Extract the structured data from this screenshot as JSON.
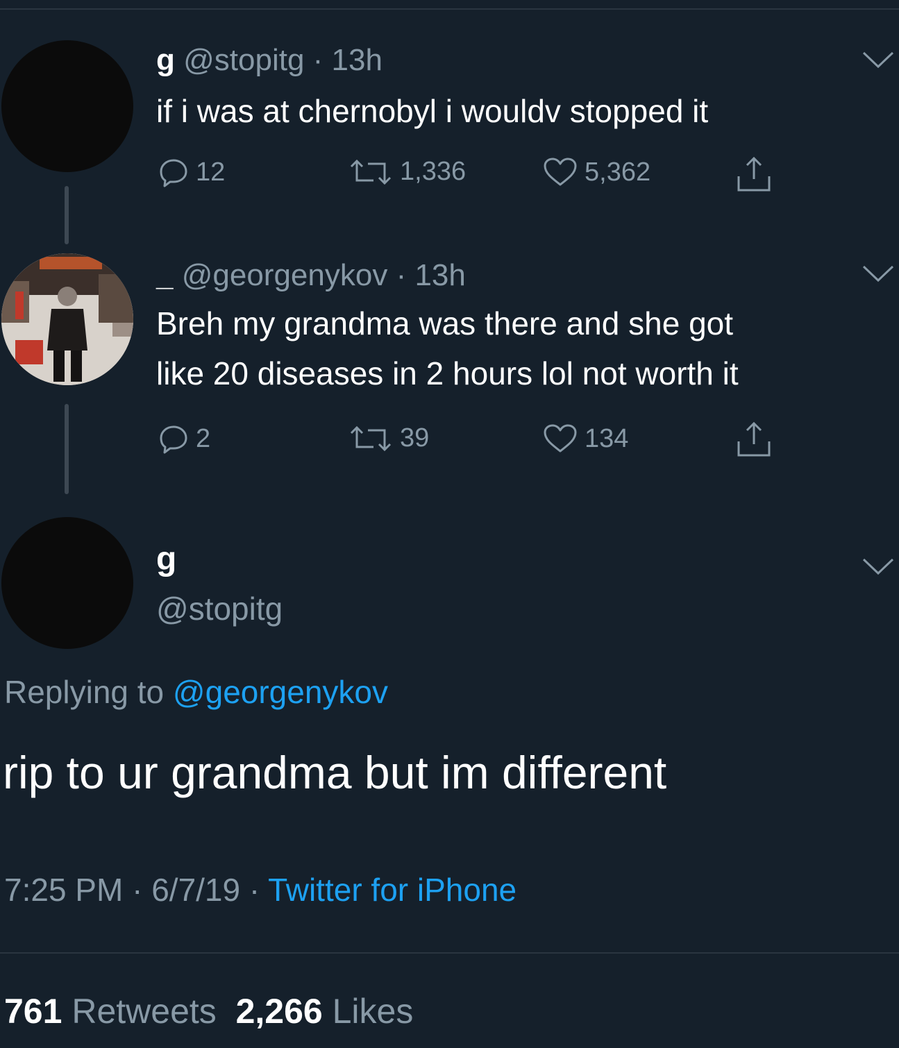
{
  "tweet1": {
    "name": "g",
    "handle": "@stopitg",
    "time": "13h",
    "text": "if i was at chernobyl i wouldv stopped it",
    "replies": "12",
    "retweets": "1,336",
    "likes": "5,362"
  },
  "tweet2": {
    "name": "_",
    "handle": "@georgenykov",
    "time": "13h",
    "text_line1": "Breh my grandma was there and she got",
    "text_line2": "like 20 diseases in 2 hours lol not worth it",
    "replies": "2",
    "retweets": "39",
    "likes": "134"
  },
  "main_tweet": {
    "name": "g",
    "handle": "@stopitg",
    "replying_prefix": "Replying to",
    "replying_to": "@georgenykov",
    "text": "rip to ur grandma but im different",
    "time": "7:25 PM",
    "date": "6/7/19",
    "source": "Twitter for iPhone",
    "retweet_count": "761",
    "retweet_label": "Retweets",
    "like_count": "2,266",
    "like_label": "Likes"
  },
  "icons": {
    "reply": "reply-icon",
    "retweet": "retweet-icon",
    "like": "heart-icon",
    "share": "share-icon",
    "menu": "chevron-down-icon"
  },
  "colors": {
    "background": "#15202b",
    "secondary_text": "#8899a6",
    "link": "#1da1f2"
  }
}
